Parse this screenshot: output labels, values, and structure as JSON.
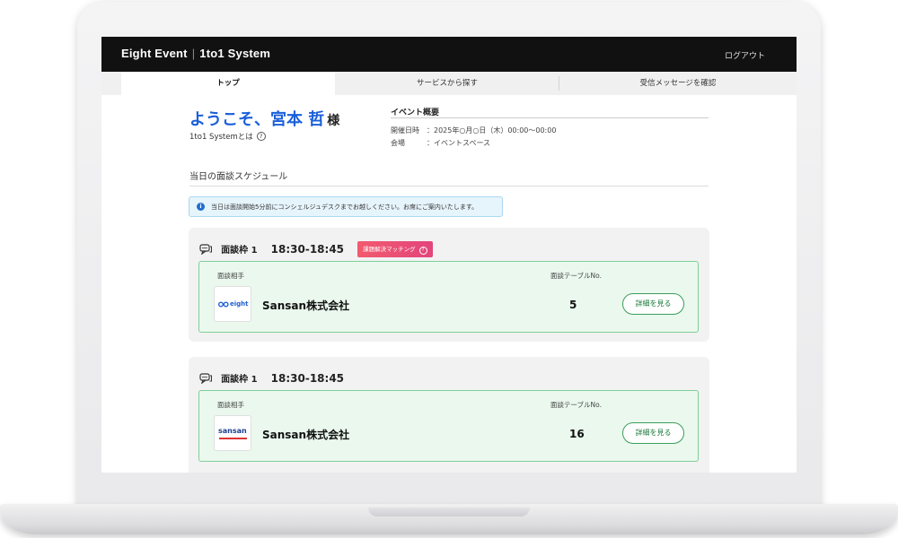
{
  "header": {
    "brand_main": "Eight Event",
    "brand_sub": "1to1 System",
    "logout": "ログアウト"
  },
  "tabs": [
    {
      "label": "トップ",
      "active": true
    },
    {
      "label": "サービスから探す",
      "active": false
    },
    {
      "label": "受信メッセージを確認",
      "active": false
    }
  ],
  "welcome": {
    "greeting": "ようこそ、宮本 哲",
    "honorific": "様",
    "about_link": "1to1 Systemとは"
  },
  "event": {
    "title": "イベント概要",
    "date_label": "開催日時",
    "date_value": "：2025年○月○日（木）00:00～00:00",
    "venue_label": "会場",
    "venue_value": "：イベントスペース"
  },
  "schedule": {
    "title": "当日の面談スケジュール",
    "notice": "当日は面談開始5分前にコンシェルジュデスクまでお越しください。お席にご案内いたします。",
    "slots": [
      {
        "label": "面談枠 1",
        "time": "18:30-18:45",
        "badge": "課題解決マッチング",
        "partner_label": "面談相手",
        "table_label": "面談テーブルNo.",
        "company": "Sansan株式会社",
        "table_no": "5",
        "logo": "eight",
        "button": "詳細を見る"
      },
      {
        "label": "面談枠 1",
        "time": "18:30-18:45",
        "badge": "",
        "partner_label": "面談相手",
        "table_label": "面談テーブルNo.",
        "company": "Sansan株式会社",
        "table_no": "16",
        "logo": "sansan",
        "button": "詳細を見る"
      }
    ]
  },
  "icons": {
    "help": "?",
    "info": "i"
  },
  "colors": {
    "accent_blue": "#1a5fd9",
    "card_green": "#eaf8ee",
    "badge_pink": "#e2457c"
  }
}
